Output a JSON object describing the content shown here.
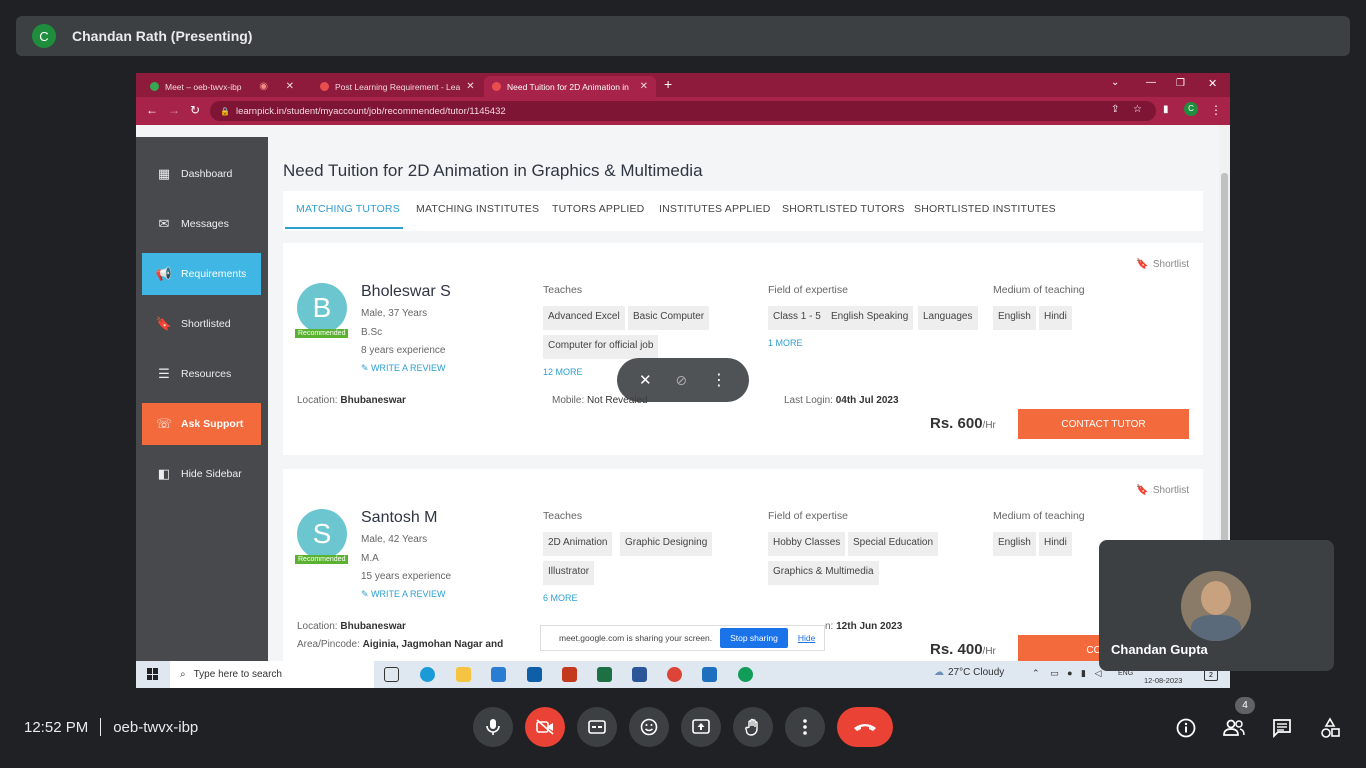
{
  "meet": {
    "presenter_initial": "C",
    "presenter_label": "Chandan Rath (Presenting)",
    "time": "12:52 PM",
    "meeting_code": "oeb-twvx-ibp",
    "self_name": "Chandan Gupta",
    "people_count": "4",
    "share_notice": "meet.google.com is sharing your screen.",
    "stop_sharing": "Stop sharing",
    "hide": "Hide"
  },
  "browser": {
    "tabs": [
      {
        "title": "Meet – oeb-twvx-ibp"
      },
      {
        "title": "Post Learning Requirement - Lea"
      },
      {
        "title": "Need Tuition for 2D Animation in"
      }
    ],
    "url": "learnpick.in/student/myaccount/job/recommended/tutor/1145432"
  },
  "sidebar": {
    "items": [
      {
        "label": "Dashboard",
        "icon": "grid-icon"
      },
      {
        "label": "Messages",
        "icon": "mail-icon"
      },
      {
        "label": "Requirements",
        "icon": "megaphone-icon"
      },
      {
        "label": "Shortlisted",
        "icon": "bookmark-icon"
      },
      {
        "label": "Resources",
        "icon": "document-icon"
      },
      {
        "label": "Ask Support",
        "icon": "support-icon"
      },
      {
        "label": "Hide Sidebar",
        "icon": "sidebar-icon"
      }
    ]
  },
  "main": {
    "title": "Need Tuition for 2D Animation in Graphics & Multimedia",
    "tabs": [
      "MATCHING TUTORS",
      "MATCHING INSTITUTES",
      "TUTORS APPLIED",
      "INSTITUTES APPLIED",
      "SHORTLISTED TUTORS",
      "SHORTLISTED INSTITUTES"
    ],
    "labels": {
      "teaches": "Teaches",
      "field": "Field of expertise",
      "medium": "Medium of teaching",
      "shortlist": "Shortlist",
      "recommended": "Recommended",
      "write_review": "WRITE A REVIEW",
      "location": "Location:",
      "mobile": "Mobile:",
      "last_login": "Last Login:",
      "area": "Area/Pincode:",
      "contact": "CONTACT TUTOR",
      "per_hr": "/Hr"
    },
    "tutors": [
      {
        "initial": "B",
        "name": "Bholeswar S",
        "gender_age": "Male, 37 Years",
        "degree": "B.Sc",
        "experience": "8 years experience",
        "teaches": [
          "Advanced Excel",
          "Basic Computer",
          "Computer for official job"
        ],
        "teaches_more": "12 MORE",
        "fields": [
          "Class 1 - 5",
          "English Speaking",
          "Languages"
        ],
        "fields_more": "1 MORE",
        "mediums": [
          "English",
          "Hindi"
        ],
        "location": "Bhubaneswar",
        "mobile": "Not Revealed",
        "last_login": "04th Jul 2023",
        "price": "Rs. 600"
      },
      {
        "initial": "S",
        "name": "Santosh M",
        "gender_age": "Male, 42 Years",
        "degree": "M.A",
        "experience": "15 years experience",
        "teaches": [
          "2D Animation",
          "Graphic Designing",
          "Illustrator"
        ],
        "teaches_more": "6 MORE",
        "fields": [
          "Hobby Classes",
          "Special Education",
          "Graphics & Multimedia"
        ],
        "mediums": [
          "English",
          "Hindi"
        ],
        "location": "Bhubaneswar",
        "area": "Aiginia, Jagmohan Nagar and",
        "last_login_partial": "n:",
        "last_login": "12th Jun 2023",
        "price": "Rs. 400",
        "contact_partial": "CONTA"
      }
    ]
  },
  "taskbar": {
    "search_placeholder": "Type here to search",
    "weather": "27°C  Cloudy",
    "lang": "ENG",
    "date": "12-08-2023",
    "notif": "2"
  }
}
